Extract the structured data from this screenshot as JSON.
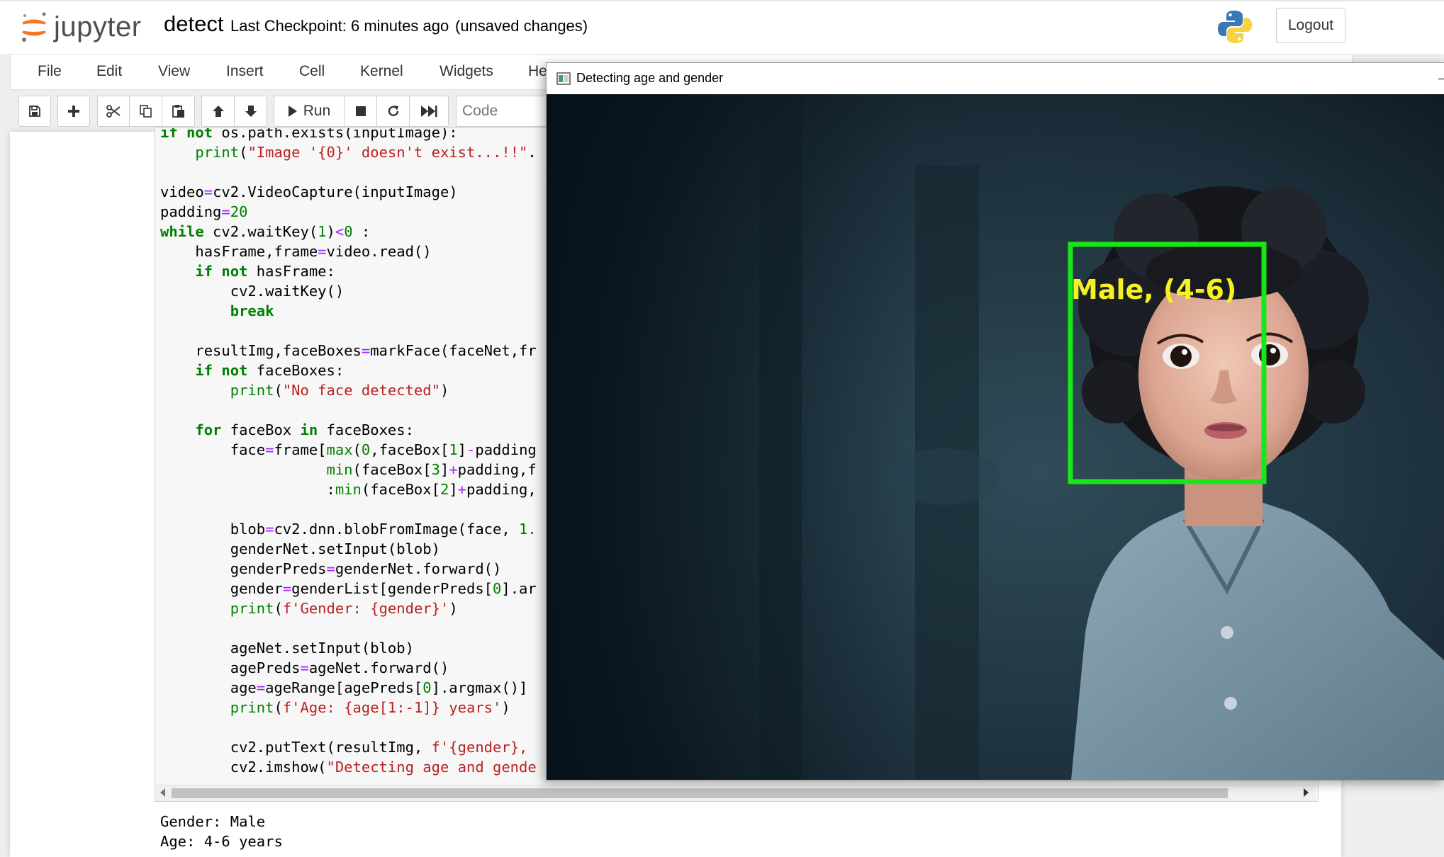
{
  "header": {
    "logo_text": "jupyter",
    "notebook_name": "detect",
    "checkpoint": "Last Checkpoint: 6 minutes ago",
    "unsaved": "(unsaved changes)",
    "logout_label": "Logout"
  },
  "menu": {
    "items": [
      "File",
      "Edit",
      "View",
      "Insert",
      "Cell",
      "Kernel",
      "Widgets",
      "He"
    ]
  },
  "toolbar": {
    "icons": [
      "save-icon",
      "plus-icon",
      "scissors-icon",
      "copy-icon",
      "paste-icon",
      "arrow-up-icon",
      "arrow-down-icon",
      "run-icon",
      "stop-icon",
      "restart-icon",
      "fast-forward-icon"
    ],
    "run_label": "Run",
    "cell_type": "Code"
  },
  "code_cell": {
    "lines": [
      "if not os.path.exists(inputImage):",
      "    print(\"Image '{0}' doesn't exist...!!\".",
      "",
      "video=cv2.VideoCapture(inputImage)",
      "padding=20",
      "while cv2.waitKey(1)<0 :",
      "    hasFrame,frame=video.read()",
      "    if not hasFrame:",
      "        cv2.waitKey()",
      "        break",
      "",
      "    resultImg,faceBoxes=markFace(faceNet,fr",
      "    if not faceBoxes:",
      "        print(\"No face detected\")",
      "",
      "    for faceBox in faceBoxes:",
      "        face=frame[max(0,faceBox[1]-padding",
      "                   min(faceBox[3]+padding,f",
      "                   :min(faceBox[2]+padding,",
      "",
      "        blob=cv2.dnn.blobFromImage(face, 1.",
      "        genderNet.setInput(blob)",
      "        genderPreds=genderNet.forward()",
      "        gender=genderList[genderPreds[0].ar",
      "        print(f'Gender: {gender}')",
      "",
      "        ageNet.setInput(blob)",
      "        agePreds=ageNet.forward()",
      "        age=ageRange[agePreds[0].argmax()]",
      "        print(f'Age: {age[1:-1]} years')",
      "",
      "        cv2.putText(resultImg, f'{gender},",
      "        cv2.imshow(\"Detecting age and gende"
    ]
  },
  "output": {
    "lines": [
      "Gender: Male",
      "Age: 4-6 years"
    ]
  },
  "cv_window": {
    "title": "Detecting age and gender",
    "detection_label": "Male, (4-6)",
    "box_color": "#19e619",
    "label_color": "#f5f023"
  },
  "colors": {
    "keyword": "#008000",
    "string": "#ba2121",
    "operator": "#aa22ff",
    "jupyter_orange": "#f37726"
  }
}
